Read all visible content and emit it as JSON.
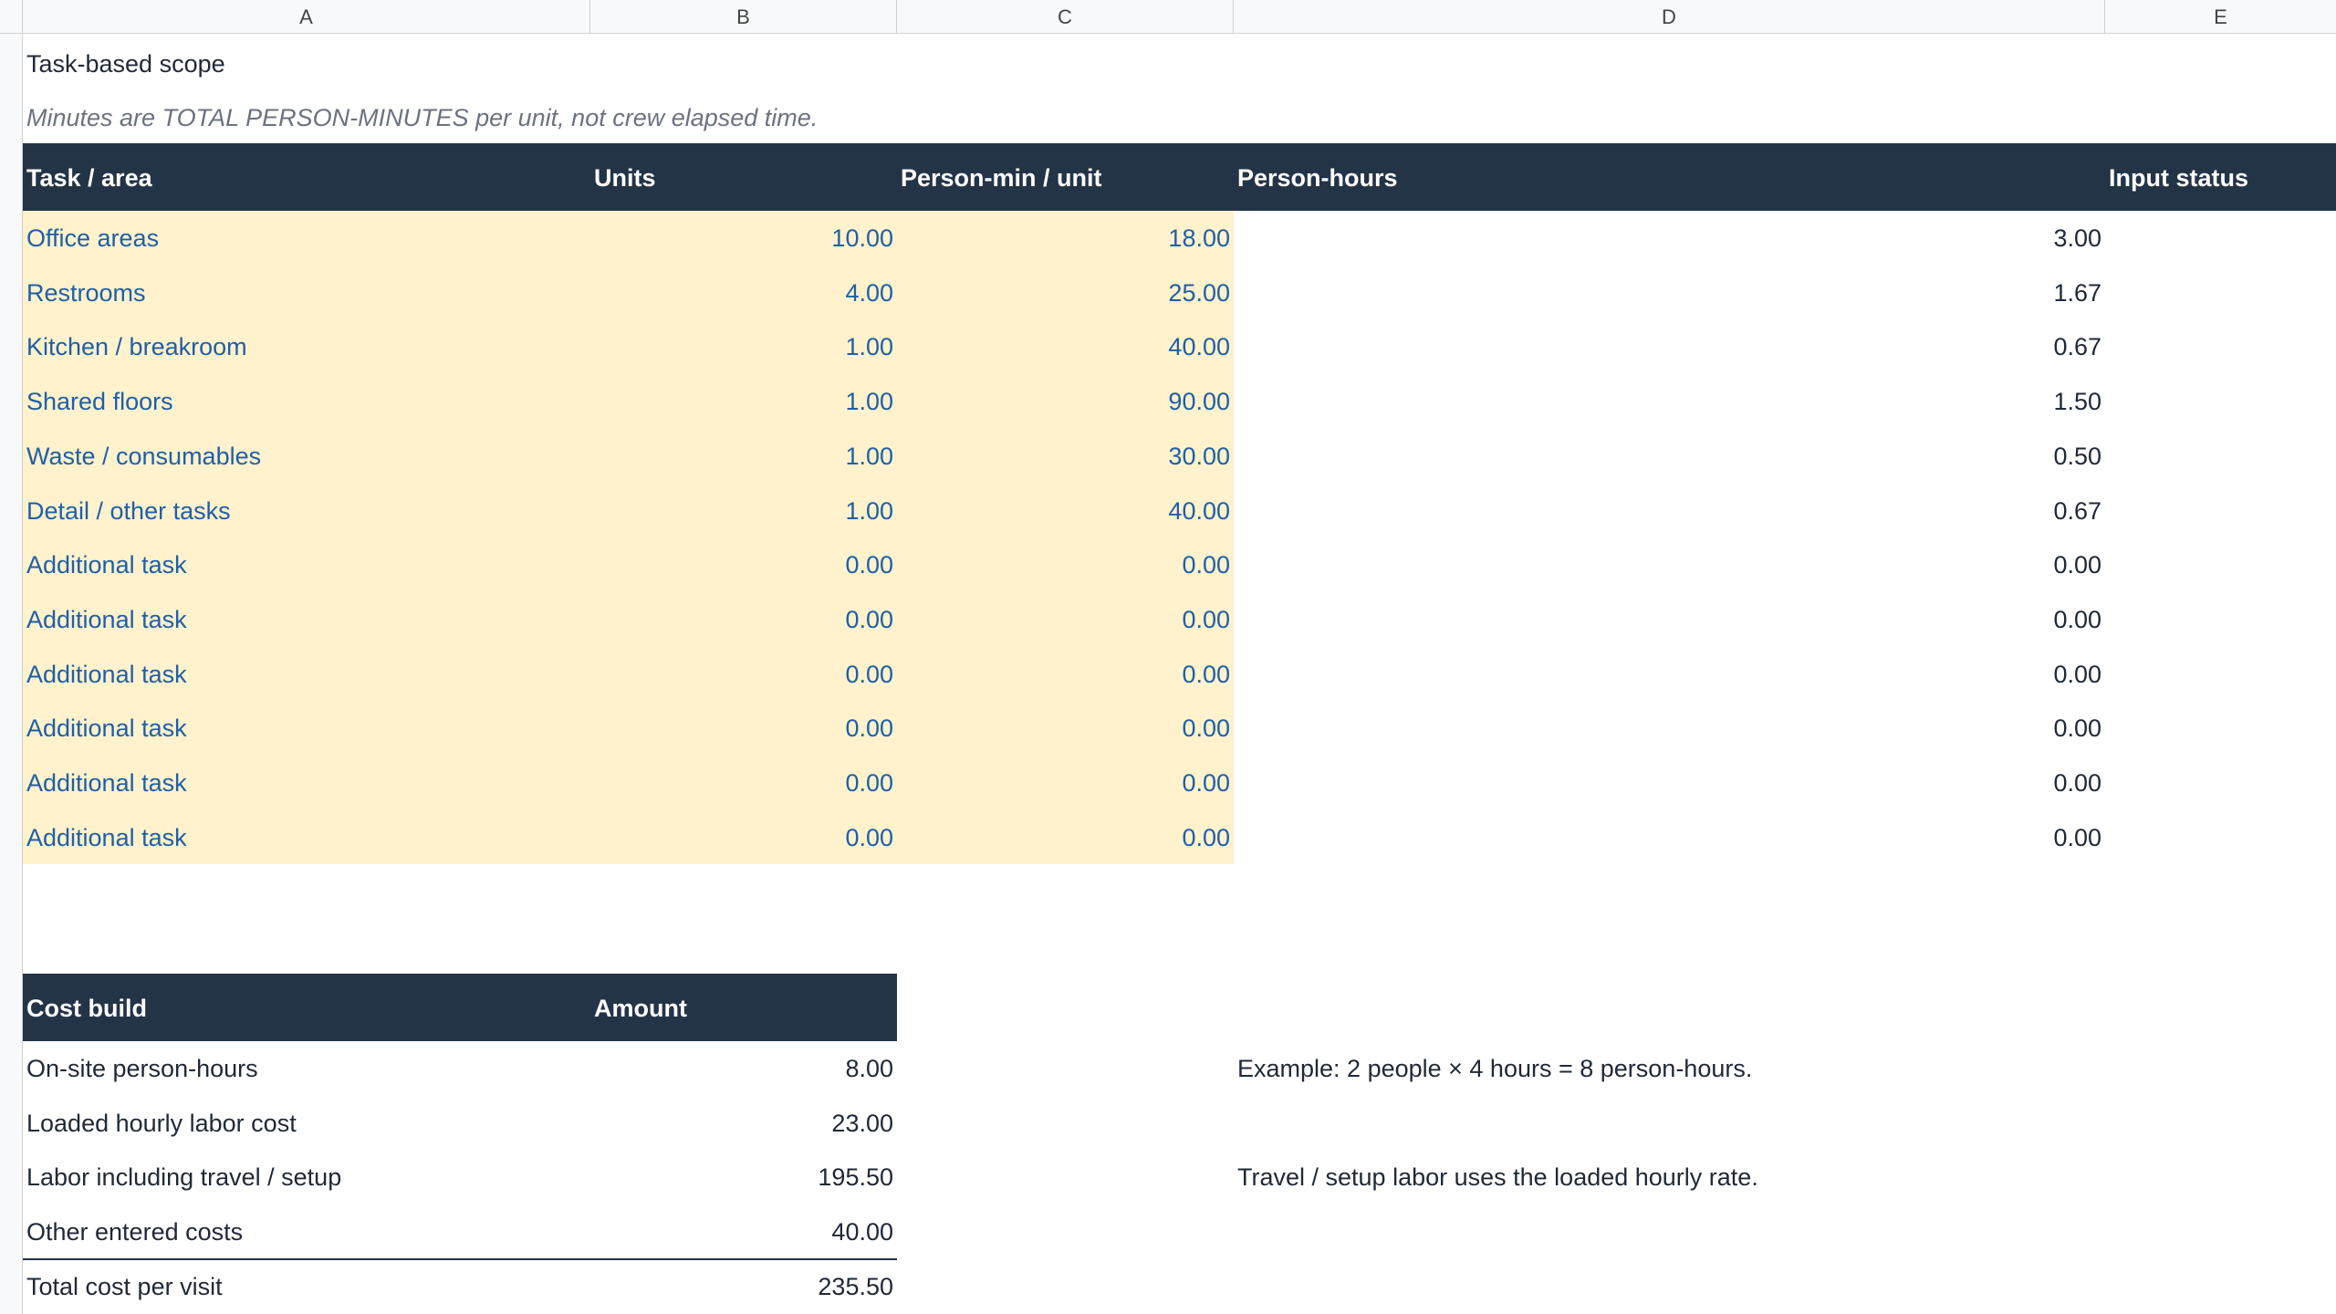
{
  "columns": [
    "A",
    "B",
    "C",
    "D",
    "E"
  ],
  "sheet_title": "Task-based scope",
  "sheet_note": "Minutes are TOTAL PERSON-MINUTES per unit, not crew elapsed time.",
  "task_table": {
    "headers": {
      "task": "Task / area",
      "units": "Units",
      "person_min": "Person-min / unit",
      "person_hours": "Person-hours",
      "input_status": "Input status"
    },
    "rows": [
      {
        "task": "Office areas",
        "units": "10.00",
        "person_min": "18.00",
        "hours": "3.00"
      },
      {
        "task": "Restrooms",
        "units": "4.00",
        "person_min": "25.00",
        "hours": "1.67"
      },
      {
        "task": "Kitchen / breakroom",
        "units": "1.00",
        "person_min": "40.00",
        "hours": "0.67"
      },
      {
        "task": "Shared floors",
        "units": "1.00",
        "person_min": "90.00",
        "hours": "1.50"
      },
      {
        "task": "Waste / consumables",
        "units": "1.00",
        "person_min": "30.00",
        "hours": "0.50"
      },
      {
        "task": "Detail / other tasks",
        "units": "1.00",
        "person_min": "40.00",
        "hours": "0.67"
      },
      {
        "task": "Additional task",
        "units": "0.00",
        "person_min": "0.00",
        "hours": "0.00"
      },
      {
        "task": "Additional task",
        "units": "0.00",
        "person_min": "0.00",
        "hours": "0.00"
      },
      {
        "task": "Additional task",
        "units": "0.00",
        "person_min": "0.00",
        "hours": "0.00"
      },
      {
        "task": "Additional task",
        "units": "0.00",
        "person_min": "0.00",
        "hours": "0.00"
      },
      {
        "task": "Additional task",
        "units": "0.00",
        "person_min": "0.00",
        "hours": "0.00"
      },
      {
        "task": "Additional task",
        "units": "0.00",
        "person_min": "0.00",
        "hours": "0.00"
      }
    ]
  },
  "cost_table": {
    "headers": {
      "label": "Cost build",
      "amount": "Amount"
    },
    "rows": [
      {
        "label": "On-site person-hours",
        "amount": "8.00",
        "note": "Example: 2 people × 4 hours = 8 person-hours."
      },
      {
        "label": "Loaded hourly labor cost",
        "amount": "23.00",
        "note": ""
      },
      {
        "label": "Labor including travel / setup",
        "amount": "195.50",
        "note": "Travel / setup labor uses the loaded hourly rate."
      },
      {
        "label": "Other entered costs",
        "amount": "40.00",
        "note": ""
      },
      {
        "label": "Total cost per visit",
        "amount": "235.50",
        "note": ""
      }
    ]
  },
  "colors": {
    "header_bg": "#243447",
    "input_bg": "#fff2cc",
    "input_text": "#1f5fa8"
  }
}
